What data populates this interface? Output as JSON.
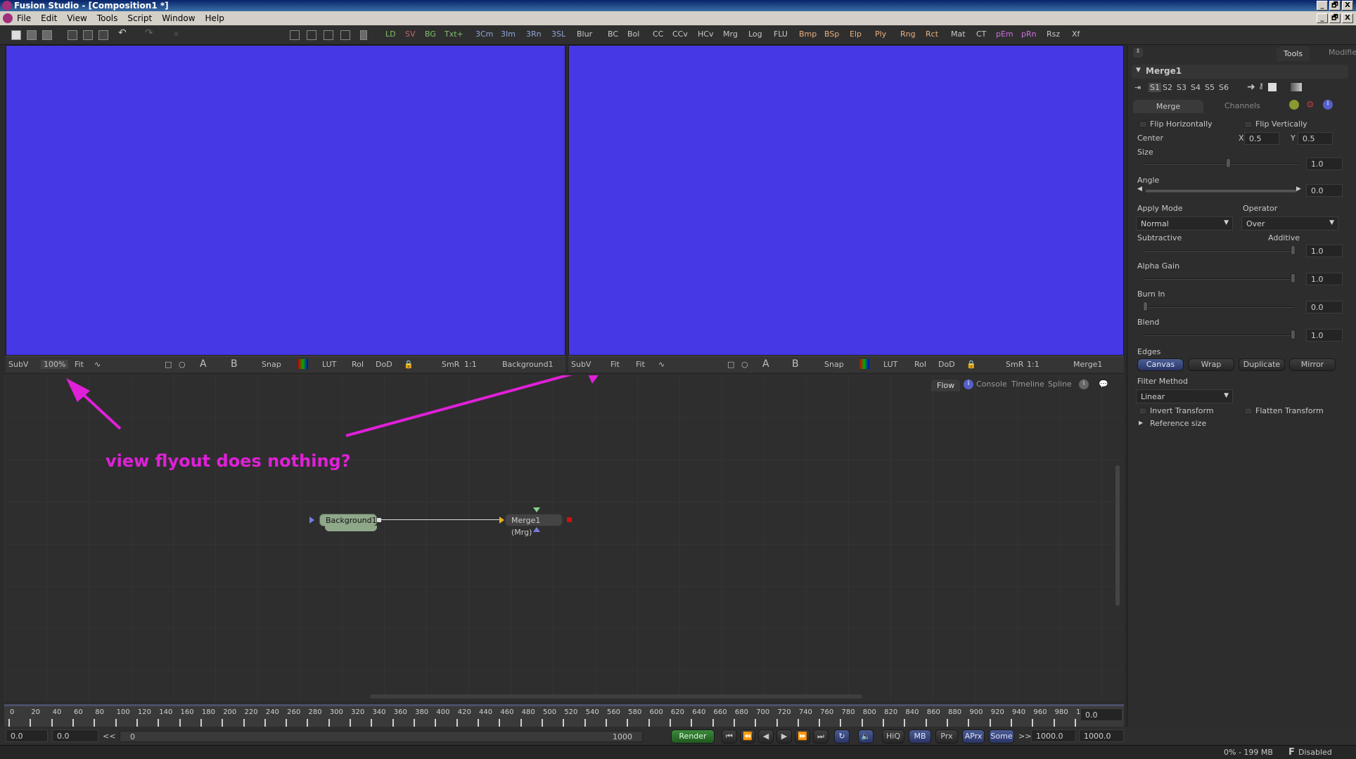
{
  "window": {
    "title": "Fusion Studio - [Composition1 *]",
    "min": "_",
    "restore": "🗗",
    "close": "X"
  },
  "menu": [
    "File",
    "Edit",
    "View",
    "Tools",
    "Script",
    "Window",
    "Help"
  ],
  "toolbar": {
    "tools": [
      {
        "label": "LD",
        "color": "#7fc06a"
      },
      {
        "label": "SV",
        "color": "#c06a6a"
      },
      {
        "label": "BG",
        "color": "#7fc06a"
      },
      {
        "label": "Txt+",
        "color": "#7fc06a"
      },
      {
        "label": "3Cm",
        "color": "#8fa8d8"
      },
      {
        "label": "3Im",
        "color": "#8fa8d8"
      },
      {
        "label": "3Rn",
        "color": "#8fa8d8"
      },
      {
        "label": "3SL",
        "color": "#8fa8d8"
      },
      {
        "label": "Blur",
        "color": "#c8c8c8"
      },
      {
        "label": "BC",
        "color": "#c8c8c8"
      },
      {
        "label": "Bol",
        "color": "#c8c8c8"
      },
      {
        "label": "CC",
        "color": "#c8c8c8"
      },
      {
        "label": "CCv",
        "color": "#c8c8c8"
      },
      {
        "label": "HCv",
        "color": "#c8c8c8"
      },
      {
        "label": "Mrg",
        "color": "#c8c8c8"
      },
      {
        "label": "Log",
        "color": "#c8c8c8"
      },
      {
        "label": "FLU",
        "color": "#c8c8c8"
      },
      {
        "label": "Bmp",
        "color": "#e8b080"
      },
      {
        "label": "BSp",
        "color": "#e8b080"
      },
      {
        "label": "Elp",
        "color": "#e8b080"
      },
      {
        "label": "Ply",
        "color": "#e8b080"
      },
      {
        "label": "Rng",
        "color": "#e8b080"
      },
      {
        "label": "Rct",
        "color": "#e8b080"
      },
      {
        "label": "Mat",
        "color": "#c8c8c8"
      },
      {
        "label": "CT",
        "color": "#c8c8c8"
      },
      {
        "label": "pEm",
        "color": "#d070e0"
      },
      {
        "label": "pRn",
        "color": "#d070e0"
      },
      {
        "label": "Rsz",
        "color": "#c8c8c8"
      },
      {
        "label": "Xf",
        "color": "#c8c8c8"
      }
    ]
  },
  "viewer_left": {
    "subv": "SubV",
    "zoom": "100%",
    "fit": "Fit",
    "snap": "Snap",
    "lut": "LUT",
    "roi": "RoI",
    "dod": "DoD",
    "smr": "SmR",
    "one": "1:1",
    "a": "A",
    "b": "B",
    "node": "Background1"
  },
  "viewer_right": {
    "subv": "SubV",
    "zoom": "Fit",
    "fit": "Fit",
    "snap": "Snap",
    "lut": "LUT",
    "roi": "RoI",
    "dod": "DoD",
    "smr": "SmR",
    "one": "1:1",
    "a": "A",
    "b": "B",
    "node": "Merge1"
  },
  "flow": {
    "tabs": [
      "Flow",
      "Console",
      "Timeline",
      "Spline"
    ],
    "nodes": {
      "bg": "Background1",
      "merge": "Merge1  (Mrg)"
    }
  },
  "annotation": "view flyout does nothing?",
  "inspector": {
    "tabs": [
      "Tools",
      "Modifiers"
    ],
    "tool": "Merge1",
    "slots": [
      "S1",
      "S2",
      "S3",
      "S4",
      "S5",
      "S6"
    ],
    "subtabs": [
      "Merge",
      "Channels"
    ],
    "flip_h": "Flip Horizontally",
    "flip_v": "Flip Vertically",
    "center_label": "Center",
    "center_x_label": "X",
    "center_x": "0.5",
    "center_y_label": "Y",
    "center_y": "0.5",
    "size_label": "Size",
    "size": "1.0",
    "size_frac": 0.55,
    "angle_label": "Angle",
    "angle": "0.0",
    "apply_mode_label": "Apply Mode",
    "apply_mode": "Normal",
    "operator_label": "Operator",
    "operator": "Over",
    "subtractive_label": "Subtractive",
    "additive_label": "Additive",
    "sub_add": "1.0",
    "alpha_gain_label": "Alpha Gain",
    "alpha_gain": "1.0",
    "burn_in_label": "Burn In",
    "burn_in": "0.0",
    "blend_label": "Blend",
    "blend": "1.0",
    "edges_label": "Edges",
    "edges": [
      "Canvas",
      "Wrap",
      "Duplicate",
      "Mirror"
    ],
    "edges_selected": "Canvas",
    "filter_label": "Filter Method",
    "filter": "Linear",
    "invert": "Invert Transform",
    "flatten": "Flatten Transform",
    "ref_size": "Reference size"
  },
  "timeline": {
    "ticks": [
      "0",
      "20",
      "40",
      "60",
      "80",
      "100",
      "120",
      "140",
      "160",
      "180",
      "200",
      "220",
      "240",
      "260",
      "280",
      "300",
      "320",
      "340",
      "360",
      "380",
      "400",
      "420",
      "440",
      "460",
      "480",
      "500",
      "520",
      "540",
      "560",
      "580",
      "600",
      "620",
      "640",
      "660",
      "680",
      "700",
      "720",
      "740",
      "760",
      "780",
      "800",
      "820",
      "840",
      "860",
      "880",
      "900",
      "920",
      "940",
      "960",
      "980",
      "1"
    ],
    "current": "0.0"
  },
  "transport": {
    "start": "0.0",
    "start2": "0.0",
    "range_start": "0",
    "range_end": "1000",
    "render": "Render",
    "hiq": "HiQ",
    "mb": "MB",
    "prx": "Prx",
    "aprx": "APrx",
    "some": "Some",
    "end1": "1000.0",
    "end2": "1000.0",
    "more": ">>",
    "less": "<<"
  },
  "status": {
    "mem": "0% -  199 MB",
    "f": "F",
    "disabled": "Disabled"
  }
}
